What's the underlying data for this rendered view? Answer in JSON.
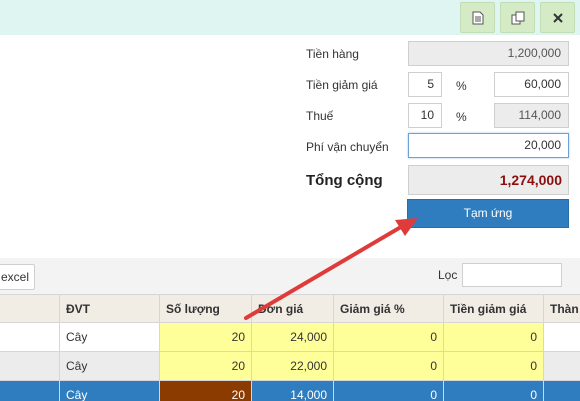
{
  "toolbar": {
    "icons": [
      "document-icon",
      "copy-icon",
      "close-icon"
    ]
  },
  "summary": {
    "tien_hang_label": "Tiền hàng",
    "tien_hang_value": "1,200,000",
    "tien_giam_gia_label": "Tiền giảm giá",
    "giam_gia_percent": "5",
    "giam_gia_value": "60,000",
    "thue_label": "Thuế",
    "thue_percent": "10",
    "thue_value": "114,000",
    "percent_sign": "%",
    "phi_van_chuyen_label": "Phí vận chuyển",
    "phi_van_chuyen_value": "20,000",
    "tong_cong_label": "Tổng cộng",
    "tong_cong_value": "1,274,000",
    "tam_ung_label": "Tạm ứng"
  },
  "list_toolbar": {
    "excel_label": "excel",
    "filter_label": "Lọc",
    "filter_value": ""
  },
  "table": {
    "columns": [
      "ĐVT",
      "Số lượng",
      "Đơn giá",
      "Giảm giá %",
      "Tiền giảm giá",
      "Thàn"
    ],
    "rows": [
      {
        "dvt": "Cây",
        "so_luong": "20",
        "don_gia": "24,000",
        "giam_gia_pct": "0",
        "tien_giam_gia": "0"
      },
      {
        "dvt": "Cây",
        "so_luong": "20",
        "don_gia": "22,000",
        "giam_gia_pct": "0",
        "tien_giam_gia": "0"
      },
      {
        "dvt": "Cây",
        "so_luong": "20",
        "don_gia": "14,000",
        "giam_gia_pct": "0",
        "tien_giam_gia": "0"
      }
    ]
  },
  "colors": {
    "accent": "#2f7dbf",
    "total_text": "#8b0e0e",
    "annotation_arrow": "#e03b3b"
  }
}
